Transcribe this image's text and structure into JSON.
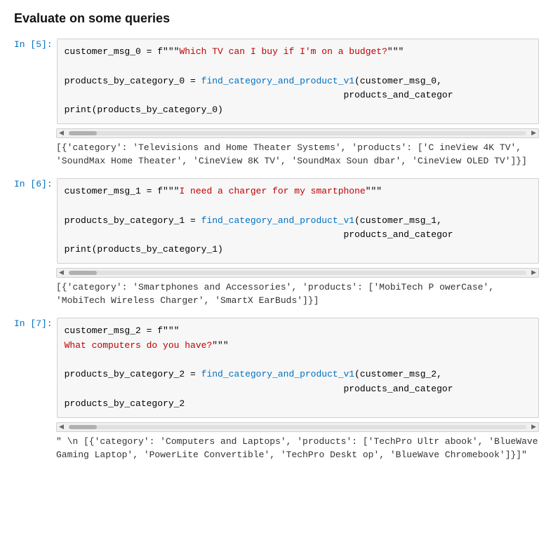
{
  "page": {
    "title": "Evaluate on some queries",
    "cells": [
      {
        "id": "cell-5",
        "label": "In [5]:",
        "lines": [
          {
            "parts": [
              {
                "text": "customer_msg_0",
                "cls": "kw-black"
              },
              {
                "text": " = ",
                "cls": "kw-black"
              },
              {
                "text": "f\"\"\"",
                "cls": "kw-black"
              },
              {
                "text": "Which TV can I buy if I'm on a budget?",
                "cls": "str-red"
              },
              {
                "text": "\"\"\"",
                "cls": "kw-black"
              }
            ]
          },
          {
            "parts": [
              {
                "text": "",
                "cls": ""
              }
            ]
          },
          {
            "parts": [
              {
                "text": "products_by_category_0",
                "cls": "kw-black"
              },
              {
                "text": " = ",
                "cls": "kw-black"
              },
              {
                "text": "find_category_and_product_v1",
                "cls": "fn-blue"
              },
              {
                "text": "(customer_msg_0,",
                "cls": "kw-black"
              }
            ]
          },
          {
            "parts": [
              {
                "text": "                                                   products_and_categor",
                "cls": "kw-black"
              }
            ]
          },
          {
            "parts": [
              {
                "text": "print",
                "cls": "kw-black"
              },
              {
                "text": "(products_by_category_0)",
                "cls": "kw-black"
              }
            ]
          }
        ],
        "output": "[{'category': 'Televisions and Home Theater Systems', 'products': ['C\nineView 4K TV', 'SoundMax Home Theater', 'CineView 8K TV', 'SoundMax Soun\ndbar', 'CineView OLED TV']}]"
      },
      {
        "id": "cell-6",
        "label": "In [6]:",
        "lines": [
          {
            "parts": [
              {
                "text": "customer_msg_1",
                "cls": "kw-black"
              },
              {
                "text": " = ",
                "cls": "kw-black"
              },
              {
                "text": "f\"\"\"",
                "cls": "kw-black"
              },
              {
                "text": "I need a charger for my smartphone",
                "cls": "str-red"
              },
              {
                "text": "\"\"\"",
                "cls": "kw-black"
              }
            ]
          },
          {
            "parts": [
              {
                "text": "",
                "cls": ""
              }
            ]
          },
          {
            "parts": [
              {
                "text": "products_by_category_1",
                "cls": "kw-black"
              },
              {
                "text": " = ",
                "cls": "kw-black"
              },
              {
                "text": "find_category_and_product_v1",
                "cls": "fn-blue"
              },
              {
                "text": "(customer_msg_1,",
                "cls": "kw-black"
              }
            ]
          },
          {
            "parts": [
              {
                "text": "                                                   products_and_categor",
                "cls": "kw-black"
              }
            ]
          },
          {
            "parts": [
              {
                "text": "print",
                "cls": "kw-black"
              },
              {
                "text": "(products_by_category_1)",
                "cls": "kw-black"
              }
            ]
          }
        ],
        "output": "[{'category': 'Smartphones and Accessories', 'products': ['MobiTech P\nowerCase', 'MobiTech Wireless Charger', 'SmartX EarBuds']}]"
      },
      {
        "id": "cell-7",
        "label": "In [7]:",
        "lines": [
          {
            "parts": [
              {
                "text": "customer_msg_2",
                "cls": "kw-black"
              },
              {
                "text": " = ",
                "cls": "kw-black"
              },
              {
                "text": "f\"\"\"",
                "cls": "kw-black"
              }
            ]
          },
          {
            "parts": [
              {
                "text": "What computers do you have?",
                "cls": "str-red"
              },
              {
                "text": "\"\"\"",
                "cls": "kw-black"
              }
            ]
          },
          {
            "parts": [
              {
                "text": "",
                "cls": ""
              }
            ]
          },
          {
            "parts": [
              {
                "text": "products_by_category_2",
                "cls": "kw-black"
              },
              {
                "text": " = ",
                "cls": "kw-black"
              },
              {
                "text": "find_category_and_product_v1",
                "cls": "fn-blue"
              },
              {
                "text": "(customer_msg_2,",
                "cls": "kw-black"
              }
            ]
          },
          {
            "parts": [
              {
                "text": "                                                   products_and_categor",
                "cls": "kw-black"
              }
            ]
          },
          {
            "parts": [
              {
                "text": "products_by_category_2",
                "cls": "kw-black"
              }
            ]
          }
        ],
        "output": "\" \\n    [{'category': 'Computers and Laptops', 'products': ['TechPro Ultr\nabook', 'BlueWave Gaming Laptop', 'PowerLite Convertible', 'TechPro Deskt\nop', 'BlueWave Chromebook']}]\""
      }
    ]
  }
}
